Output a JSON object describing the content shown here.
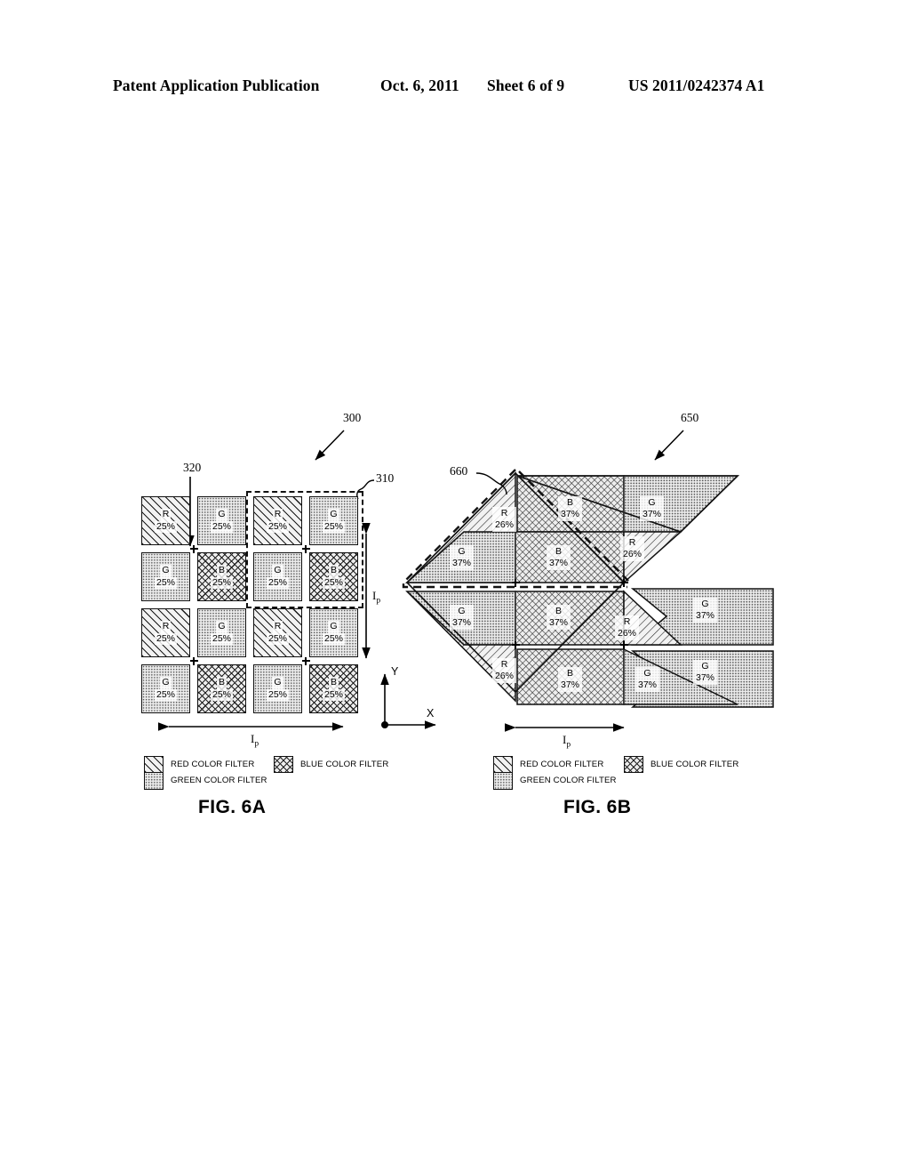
{
  "header": {
    "publication": "Patent Application Publication",
    "date": "Oct. 6, 2011",
    "sheet": "Sheet 6 of 9",
    "patent_number": "US 2011/0242374 A1"
  },
  "figures": [
    {
      "id": "fig-6a",
      "caption": "FIG. 6A",
      "reference_labels": [
        {
          "name": "assembly-ref",
          "text": "300"
        },
        {
          "name": "pixel-ref",
          "text": "320"
        },
        {
          "name": "quad-ref",
          "text": "310"
        }
      ],
      "dimension_labels": [
        {
          "name": "horizontal-pitch",
          "text": "I",
          "sub": "p"
        },
        {
          "name": "vertical-pitch",
          "text": "I",
          "sub": "p"
        }
      ],
      "grid": {
        "rows": 4,
        "cols": 4,
        "cells": [
          {
            "color": "R",
            "pct": "25%"
          },
          {
            "color": "G",
            "pct": "25%"
          },
          {
            "color": "R",
            "pct": "25%"
          },
          {
            "color": "G",
            "pct": "25%"
          },
          {
            "color": "G",
            "pct": "25%"
          },
          {
            "color": "B",
            "pct": "25%"
          },
          {
            "color": "G",
            "pct": "25%"
          },
          {
            "color": "B",
            "pct": "25%"
          },
          {
            "color": "R",
            "pct": "25%"
          },
          {
            "color": "G",
            "pct": "25%"
          },
          {
            "color": "R",
            "pct": "25%"
          },
          {
            "color": "G",
            "pct": "25%"
          },
          {
            "color": "G",
            "pct": "25%"
          },
          {
            "color": "B",
            "pct": "25%"
          },
          {
            "color": "G",
            "pct": "25%"
          },
          {
            "color": "B",
            "pct": "25%"
          }
        ]
      }
    },
    {
      "id": "fig-6b",
      "caption": "FIG. 6B",
      "reference_labels": [
        {
          "name": "assembly-ref",
          "text": "650"
        },
        {
          "name": "unit-cell-ref",
          "text": "660"
        }
      ],
      "dimension_labels": [
        {
          "name": "horizontal-pitch",
          "text": "I",
          "sub": "p"
        }
      ],
      "axes": {
        "x": "X",
        "y": "Y"
      },
      "regions": [
        {
          "name": "r-top-left",
          "color": "R",
          "pct": "26%"
        },
        {
          "name": "b-top-middle",
          "color": "B",
          "pct": "37%"
        },
        {
          "name": "g-top-right",
          "color": "G",
          "pct": "37%"
        },
        {
          "name": "g-upper-left",
          "color": "G",
          "pct": "37%"
        },
        {
          "name": "b-upper-middle",
          "color": "B",
          "pct": "37%"
        },
        {
          "name": "r-upper-right",
          "color": "R",
          "pct": "26%"
        },
        {
          "name": "g-right-upper",
          "color": "G",
          "pct": "37%"
        },
        {
          "name": "g-lower-left",
          "color": "G",
          "pct": "37%"
        },
        {
          "name": "b-lower-middle",
          "color": "B",
          "pct": "37%"
        },
        {
          "name": "r-lower-right",
          "color": "R",
          "pct": "26%"
        },
        {
          "name": "g-right-lower",
          "color": "G",
          "pct": "37%"
        },
        {
          "name": "r-bottom-left",
          "color": "R",
          "pct": "26%"
        },
        {
          "name": "b-bottom-middle",
          "color": "B",
          "pct": "37%"
        },
        {
          "name": "g-bottom-right",
          "color": "G",
          "pct": "37%"
        }
      ]
    }
  ],
  "legend": {
    "red": "RED COLOR FILTER",
    "green": "GREEN COLOR FILTER",
    "blue": "BLUE COLOR FILTER"
  }
}
